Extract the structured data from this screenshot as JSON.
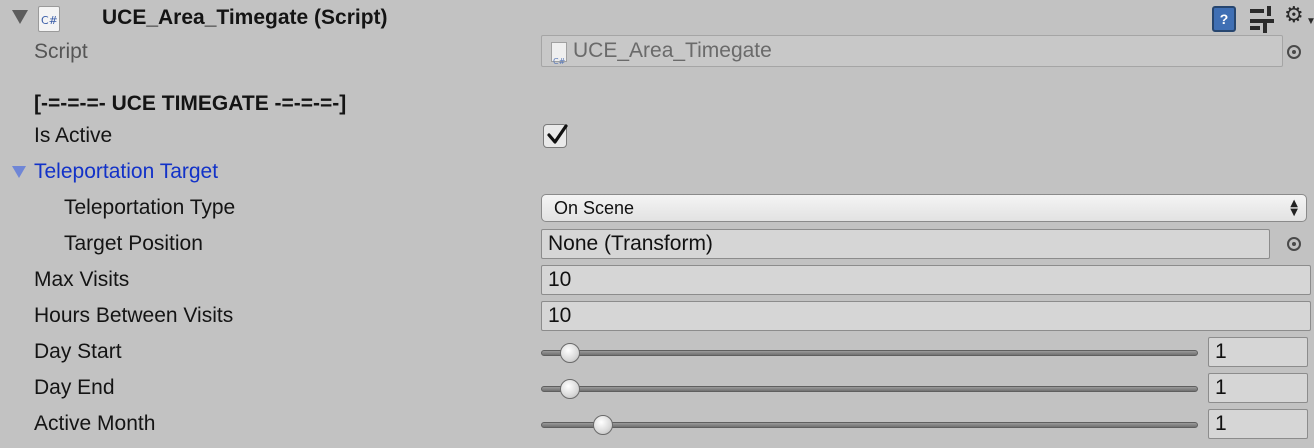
{
  "component": {
    "title": "UCE_Area_Timegate (Script)",
    "cs_icon_text": "C#",
    "help_icon_text": "?"
  },
  "fields": {
    "script_label": "Script",
    "script_value": "UCE_Area_Timegate",
    "header_text": "[-=-=-=- UCE TIMEGATE -=-=-=-]",
    "is_active_label": "Is Active",
    "is_active_value": true,
    "teleport_foldout_label": "Teleportation Target",
    "teleport_type_label": "Teleportation Type",
    "teleport_type_value": "On Scene",
    "target_position_label": "Target Position",
    "target_position_value": "None (Transform)",
    "max_visits_label": "Max Visits",
    "max_visits_value": "10",
    "hours_between_label": "Hours Between Visits",
    "hours_between_value": "10",
    "day_start_label": "Day Start",
    "day_start_value": "1",
    "day_end_label": "Day End",
    "day_end_value": "1",
    "active_month_label": "Active Month",
    "active_month_value": "1"
  },
  "sliders": {
    "day_start": {
      "min": 1,
      "max": 31,
      "value": 1
    },
    "day_end": {
      "min": 1,
      "max": 31,
      "value": 1
    },
    "active_month": {
      "min": 1,
      "max": 12,
      "value": 1
    }
  },
  "colors": {
    "background": "#c2c2c2",
    "foldout_label": "#1232c8",
    "help_icon": "#3f6fb4"
  },
  "icons": [
    "foldout-arrow-icon",
    "csharp-script-icon",
    "help-icon",
    "preset-icon",
    "gear-icon",
    "object-picker-icon",
    "checkmark-icon",
    "dropdown-arrow-icon"
  ]
}
